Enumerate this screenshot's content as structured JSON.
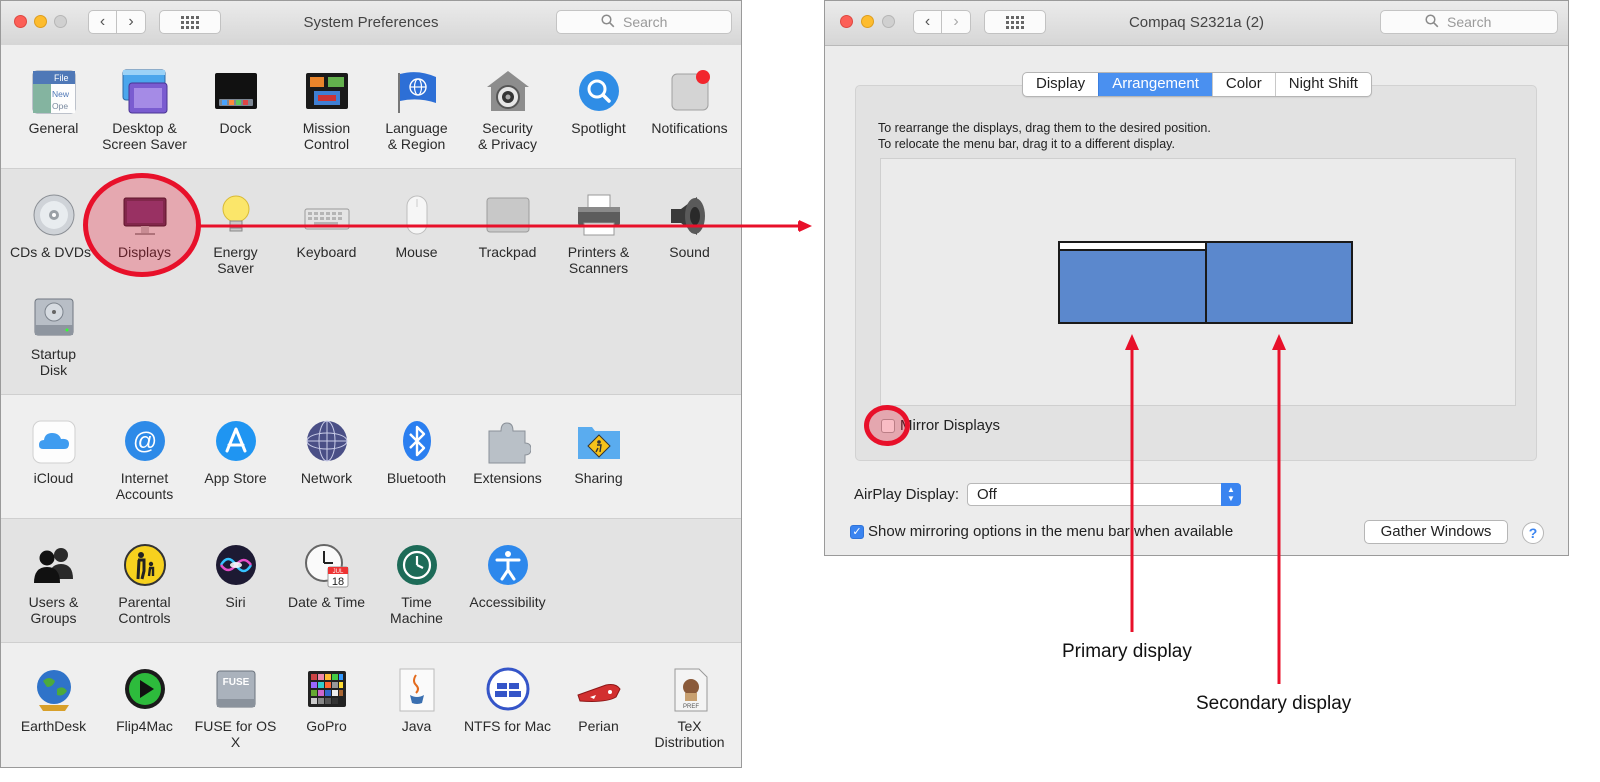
{
  "sysprefs": {
    "title": "System Preferences",
    "search_placeholder": "Search",
    "rows": [
      [
        {
          "label": "General",
          "icon": "general-icon"
        },
        {
          "label": "Desktop &\nScreen Saver",
          "icon": "desktop-screensaver-icon"
        },
        {
          "label": "Dock",
          "icon": "dock-icon"
        },
        {
          "label": "Mission\nControl",
          "icon": "mission-control-icon"
        },
        {
          "label": "Language\n& Region",
          "icon": "language-region-icon"
        },
        {
          "label": "Security\n& Privacy",
          "icon": "security-privacy-icon"
        },
        {
          "label": "Spotlight",
          "icon": "spotlight-icon"
        },
        {
          "label": "Notifications",
          "icon": "notifications-icon"
        }
      ],
      [
        {
          "label": "CDs & DVDs",
          "icon": "cds-dvds-icon"
        },
        {
          "label": "Displays",
          "icon": "displays-icon"
        },
        {
          "label": "Energy\nSaver",
          "icon": "energy-saver-icon"
        },
        {
          "label": "Keyboard",
          "icon": "keyboard-icon"
        },
        {
          "label": "Mouse",
          "icon": "mouse-icon"
        },
        {
          "label": "Trackpad",
          "icon": "trackpad-icon"
        },
        {
          "label": "Printers &\nScanners",
          "icon": "printers-scanners-icon"
        },
        {
          "label": "Sound",
          "icon": "sound-icon"
        }
      ],
      [
        {
          "label": "Startup\nDisk",
          "icon": "startup-disk-icon"
        }
      ],
      [
        {
          "label": "iCloud",
          "icon": "icloud-icon"
        },
        {
          "label": "Internet\nAccounts",
          "icon": "internet-accounts-icon"
        },
        {
          "label": "App Store",
          "icon": "app-store-icon"
        },
        {
          "label": "Network",
          "icon": "network-icon"
        },
        {
          "label": "Bluetooth",
          "icon": "bluetooth-icon"
        },
        {
          "label": "Extensions",
          "icon": "extensions-icon"
        },
        {
          "label": "Sharing",
          "icon": "sharing-icon"
        }
      ],
      [
        {
          "label": "Users &\nGroups",
          "icon": "users-groups-icon"
        },
        {
          "label": "Parental\nControls",
          "icon": "parental-controls-icon"
        },
        {
          "label": "Siri",
          "icon": "siri-icon"
        },
        {
          "label": "Date & Time",
          "icon": "date-time-icon"
        },
        {
          "label": "Time\nMachine",
          "icon": "time-machine-icon"
        },
        {
          "label": "Accessibility",
          "icon": "accessibility-icon"
        }
      ],
      [
        {
          "label": "EarthDesk",
          "icon": "earthdesk-icon"
        },
        {
          "label": "Flip4Mac",
          "icon": "flip4mac-icon"
        },
        {
          "label": "FUSE for OS X",
          "icon": "fuse-icon"
        },
        {
          "label": "GoPro",
          "icon": "gopro-icon"
        },
        {
          "label": "Java",
          "icon": "java-icon"
        },
        {
          "label": "NTFS for Mac",
          "icon": "ntfs-icon"
        },
        {
          "label": "Perian",
          "icon": "perian-icon"
        },
        {
          "label": "TeX\nDistribution",
          "icon": "tex-icon"
        }
      ]
    ],
    "icon_text": {
      "general_file": "File",
      "general_new": "New",
      "general_open": "Ope",
      "fuse_badge": "FUSE",
      "calendar_month": "JUL",
      "calendar_day": "18",
      "tex_badge": "PREF"
    }
  },
  "displays_window": {
    "title": "Compaq S2321a (2)",
    "search_placeholder": "Search",
    "tabs": [
      "Display",
      "Arrangement",
      "Color",
      "Night Shift"
    ],
    "selected_tab": "Arrangement",
    "instructions_line1": "To rearrange the displays, drag them to the desired position.",
    "instructions_line2": "To relocate the menu bar, drag it to a different display.",
    "mirror_label": "Mirror Displays",
    "mirror_checked": false,
    "airplay_label": "AirPlay Display:",
    "airplay_value": "Off",
    "show_mirroring_label": "Show mirroring options in the menu bar when available",
    "show_mirroring_checked": true,
    "gather_button": "Gather Windows",
    "help_glyph": "?"
  },
  "annotations": {
    "primary": "Primary display",
    "secondary": "Secondary display",
    "accent_color": "#e8102a"
  }
}
